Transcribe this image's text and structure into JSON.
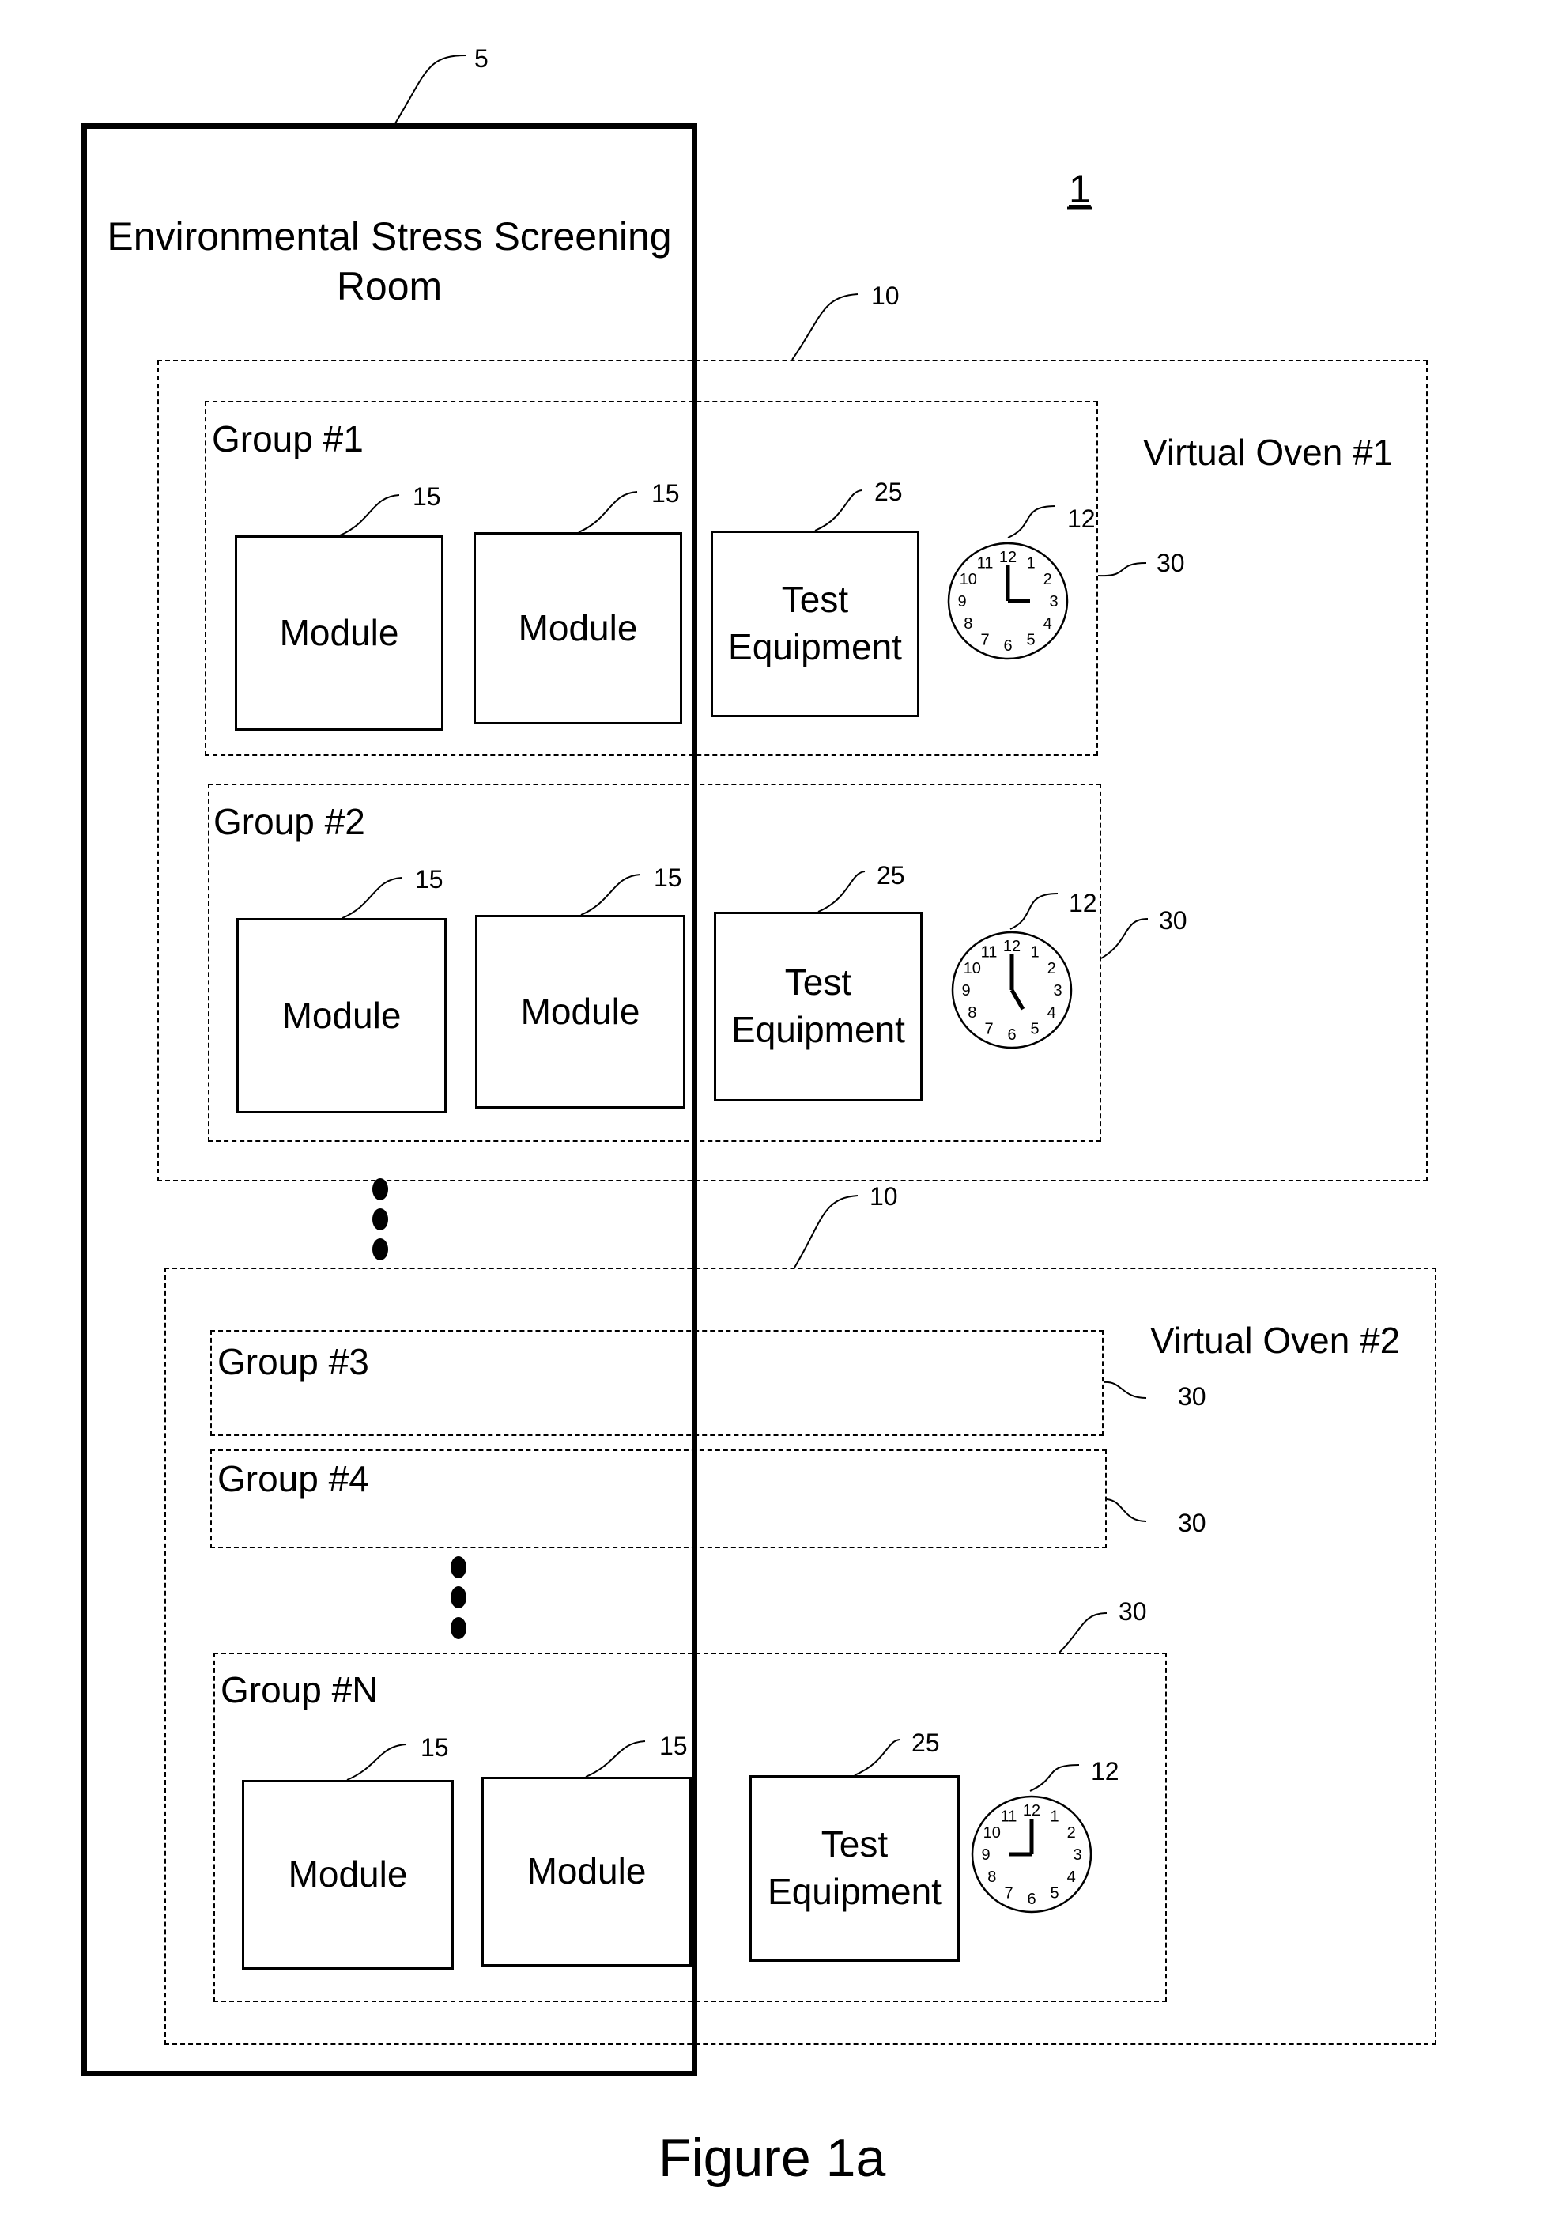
{
  "figure": {
    "caption": "Figure 1a",
    "system_ref": "1"
  },
  "room": {
    "title_line1": "Environmental Stress Screening",
    "title_line2": "Room",
    "ref": "5"
  },
  "ovens": [
    {
      "label": "Virtual Oven #1",
      "ref": "10",
      "groups": [
        {
          "label": "Group #1",
          "ref": "30",
          "modules": [
            "Module",
            "Module"
          ],
          "module_ref": "15",
          "equipment_line1": "Test",
          "equipment_line2": "Equipment",
          "equipment_ref": "25",
          "clock_ref": "12",
          "clock_time": "3:00"
        },
        {
          "label": "Group #2",
          "ref": "30",
          "modules": [
            "Module",
            "Module"
          ],
          "module_ref": "15",
          "equipment_line1": "Test",
          "equipment_line2": "Equipment",
          "equipment_ref": "25",
          "clock_ref": "12",
          "clock_time": "5:00"
        }
      ]
    },
    {
      "label": "Virtual Oven #2",
      "ref": "10",
      "groups": [
        {
          "label": "Group #3",
          "ref": "30"
        },
        {
          "label": "Group #4",
          "ref": "30"
        },
        {
          "label": "Group #N",
          "ref": "30",
          "modules": [
            "Module",
            "Module"
          ],
          "module_ref": "15",
          "equipment_line1": "Test",
          "equipment_line2": "Equipment",
          "equipment_ref": "25",
          "clock_ref": "12",
          "clock_time": "9:00"
        }
      ]
    }
  ],
  "clock_numbers": [
    "12",
    "1",
    "2",
    "3",
    "4",
    "5",
    "6",
    "7",
    "8",
    "9",
    "10",
    "11"
  ]
}
